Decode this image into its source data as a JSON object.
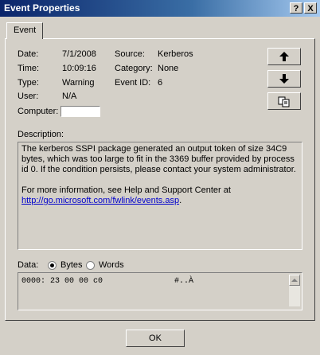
{
  "window": {
    "title": "Event Properties",
    "help_label": "?",
    "close_label": "X"
  },
  "tabs": [
    "Event"
  ],
  "event": {
    "date_label": "Date:",
    "date": "7/1/2008",
    "time_label": "Time:",
    "time": "10:09:16",
    "type_label": "Type:",
    "type": "Warning",
    "user_label": "User:",
    "user": "N/A",
    "computer_label": "Computer:",
    "computer": "",
    "source_label": "Source:",
    "source": "Kerberos",
    "category_label": "Category:",
    "category": "None",
    "eventid_label": "Event ID:",
    "eventid": "6"
  },
  "side_buttons": [
    "arrow-up-icon",
    "arrow-down-icon",
    "copy-icon"
  ],
  "description": {
    "label": "Description:",
    "paragraph1": "The kerberos SSPI package generated an output token of size 34C9 bytes, which was too large to fit in the 3369 buffer provided by process id 0.  If the condition persists, please contact your system administrator.",
    "paragraph2": "For more information, see Help and Support Center at",
    "link": "http://go.microsoft.com/fwlink/events.asp",
    "link_suffix": "."
  },
  "data": {
    "label": "Data:",
    "bytes_label": "Bytes",
    "words_label": "Words",
    "selected": "Bytes",
    "line": "0000: 23 00 00 c0               #..À"
  },
  "footer": {
    "ok_label": "OK"
  }
}
